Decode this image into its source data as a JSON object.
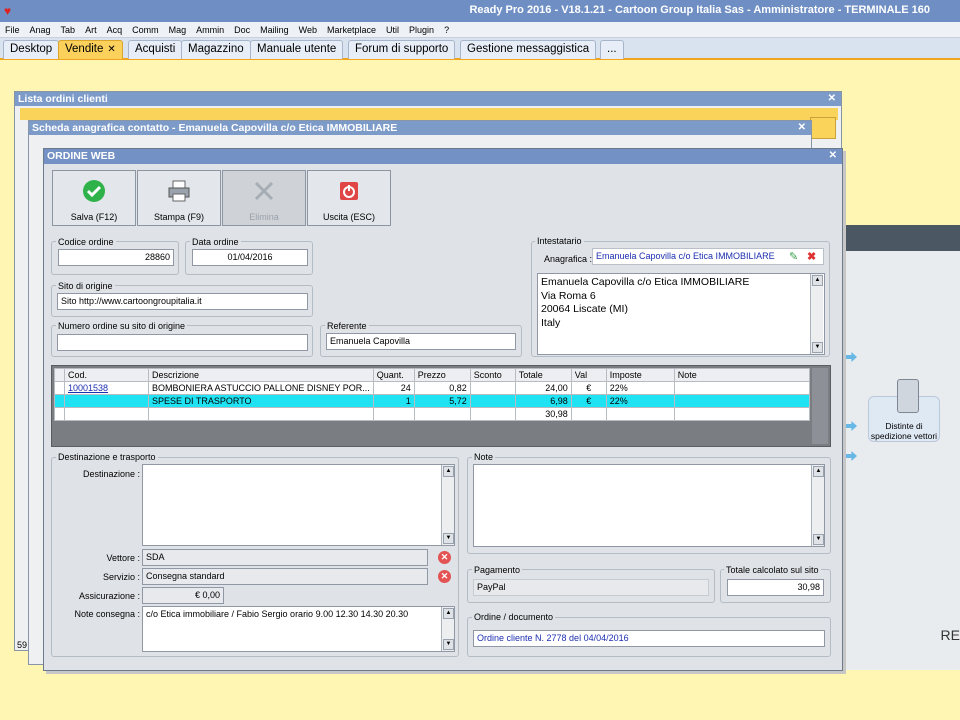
{
  "app": {
    "title": "Ready Pro 2016 - V18.1.21 - Cartoon Group Italia Sas - Amministratore - TERMINALE 160"
  },
  "menu": [
    "File",
    "Anag",
    "Tab",
    "Art",
    "Acq",
    "Comm",
    "Mag",
    "Ammin",
    "Doc",
    "Mailing",
    "Web",
    "Marketplace",
    "Util",
    "Plugin",
    "?"
  ],
  "tabs": [
    "Desktop",
    "Vendite",
    "Acquisti",
    "Magazzino",
    "Manuale utente",
    "Forum di supporto",
    "Gestione messaggistica",
    "..."
  ],
  "active_tab": "Vendite",
  "background": {
    "list_window_title": "Lista ordini clienti",
    "contact_window_title": "Scheda anagrafica contatto - Emanuela Capovilla c/o Etica IMMOBILIARE",
    "distinte_label": "Distinte di spedizione vettori",
    "re_text": "RE"
  },
  "order": {
    "window_title": "ORDINE WEB",
    "toolbar": {
      "save": "Salva (F12)",
      "print": "Stampa (F9)",
      "delete": "Elimina",
      "exit": "Uscita (ESC)"
    },
    "codice_label": "Codice ordine",
    "codice_value": "28860",
    "data_label": "Data ordine",
    "data_value": "01/04/2016",
    "sito_label": "Sito di origine",
    "sito_value": "Sito http://www.cartoongroupitalia.it",
    "numero_label": "Numero ordine su sito di origine",
    "numero_value": "",
    "referente_label": "Referente",
    "referente_value": "Emanuela Capovilla",
    "intestatario_label": "Intestatario",
    "anagrafica_label": "Anagrafica :",
    "anagrafica_value": "Emanuela Capovilla c/o Etica IMMOBILIARE",
    "address": {
      "line1": "Emanuela Capovilla c/o Etica IMMOBILIARE",
      "line2": "Via Roma  6",
      "line3": "20064 Liscate (MI)",
      "line4": "Italy"
    },
    "grid": {
      "headers": [
        "Cod.",
        "Descrizione",
        "Quant.",
        "Prezzo",
        "Sconto",
        "Totale",
        "Val",
        "Imposte",
        "Note"
      ],
      "rows": [
        {
          "cod": "10001538",
          "descrizione": "BOMBONIERA ASTUCCIO PALLONE DISNEY POR...",
          "quant": "24",
          "prezzo": "0,82",
          "sconto": "",
          "totale": "24,00",
          "val": "€",
          "imposte": "22%",
          "note": ""
        },
        {
          "cod": "",
          "descrizione": "SPESE DI TRASPORTO",
          "quant": "1",
          "prezzo": "5,72",
          "sconto": "",
          "totale": "6,98",
          "val": "€",
          "imposte": "22%",
          "note": ""
        }
      ],
      "total": "30,98"
    },
    "dest_group_label": "Destinazione e trasporto",
    "destinazione_label": "Destinazione :",
    "destinazione_value": "",
    "vettore_label": "Vettore :",
    "vettore_value": "SDA",
    "servizio_label": "Servizio :",
    "servizio_value": "Consegna standard",
    "assicurazione_label": "Assicurazione :",
    "assicurazione_value": "€ 0,00",
    "note_consegna_label": "Note consegna :",
    "note_consegna_value": "c/o Etica immobiliare / Fabio Sergio orario 9.00 12.30    14.30 20.30",
    "note_label": "Note",
    "note_value": "",
    "pagamento_label": "Pagamento",
    "pagamento_value": "PayPal",
    "totale_sito_label": "Totale calcolato sul sito",
    "totale_sito_value": "30,98",
    "ordine_doc_label": "Ordine / documento",
    "ordine_doc_value": "Ordine cliente N. 2778 del 04/04/2016"
  },
  "colors": {
    "title": "#6f8fc4",
    "selected_row": "#1fe3f3",
    "active_tab": "#fbd15b",
    "background": "#fef6b2"
  }
}
